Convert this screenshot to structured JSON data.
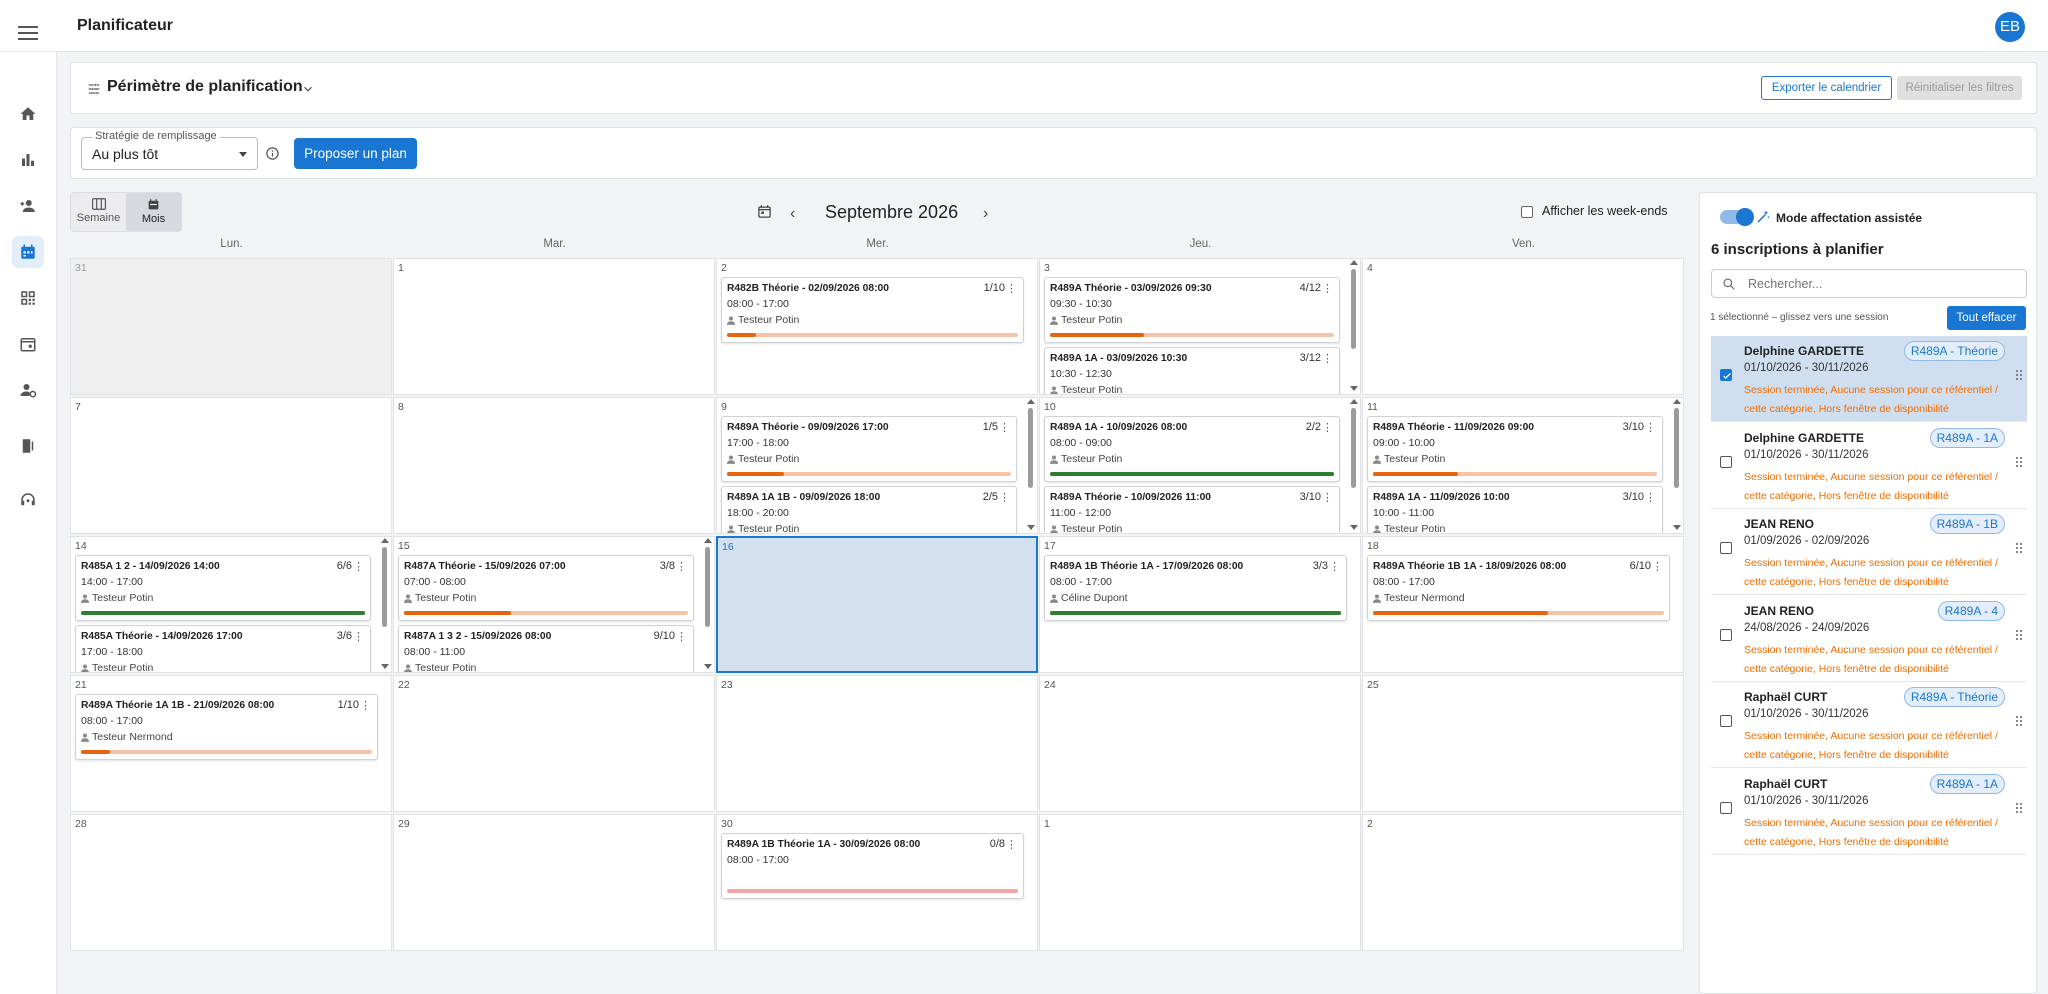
{
  "app": {
    "title": "Planificateur",
    "user_initials": "EB"
  },
  "sidebar": {
    "items": [
      {
        "icon": "home-icon"
      },
      {
        "icon": "bar-chart-icon"
      },
      {
        "icon": "user-add-icon"
      },
      {
        "icon": "calendar-icon",
        "active": true
      },
      {
        "icon": "qr-code-icon"
      },
      {
        "icon": "event-icon"
      },
      {
        "icon": "user-manage-icon"
      },
      {
        "icon": "exit-door-icon"
      },
      {
        "icon": "support-icon"
      }
    ]
  },
  "scope": {
    "title": "Périmètre de planification",
    "export_label": "Exporter le calendrier",
    "reset_label": "Réinitialiser les filtres"
  },
  "strategy": {
    "label": "Stratégie de remplissage",
    "value": "Au plus tôt",
    "propose_label": "Proposer un plan"
  },
  "view": {
    "week_label": "Semaine",
    "month_label": "Mois",
    "active": "Mois"
  },
  "calendar": {
    "month_label": "Septembre 2026",
    "show_weekends_label": "Afficher les week-ends",
    "days_of_week": [
      "Lun.",
      "Mar.",
      "Mer.",
      "Jeu.",
      "Ven."
    ],
    "weeks": [
      [
        {
          "day": "31",
          "other": true,
          "events": []
        },
        {
          "day": "1",
          "events": []
        },
        {
          "day": "2",
          "events": [
            {
              "title": "R482B Théorie - 02/09/2026 08:00",
              "count": "1/10",
              "time": "08:00 - 17:00",
              "trainer": "Testeur Potin",
              "fill": 0.1,
              "color": "#e8650f"
            }
          ]
        },
        {
          "day": "3",
          "scroll": true,
          "events": [
            {
              "title": "R489A Théorie - 03/09/2026 09:30",
              "count": "4/12",
              "time": "09:30 - 10:30",
              "trainer": "Testeur Potin",
              "fill": 0.33,
              "color": "#e8650f"
            },
            {
              "title": "R489A 1A - 03/09/2026 10:30",
              "count": "3/12",
              "time": "10:30 - 12:30",
              "trainer": "Testeur Potin",
              "fill": 0.25,
              "color": "#e8650f"
            }
          ]
        },
        {
          "day": "4",
          "events": []
        }
      ],
      [
        {
          "day": "7",
          "events": []
        },
        {
          "day": "8",
          "events": []
        },
        {
          "day": "9",
          "scroll": true,
          "events": [
            {
              "title": "R489A Théorie - 09/09/2026 17:00",
              "count": "1/5",
              "time": "17:00 - 18:00",
              "trainer": "Testeur Potin",
              "fill": 0.2,
              "color": "#e8650f"
            },
            {
              "title": "R489A 1A 1B - 09/09/2026 18:00",
              "count": "2/5",
              "time": "18:00 - 20:00",
              "trainer": "Testeur Potin",
              "fill": 0.4,
              "color": "#e8650f"
            }
          ]
        },
        {
          "day": "10",
          "scroll": true,
          "events": [
            {
              "title": "R489A 1A - 10/09/2026 08:00",
              "count": "2/2",
              "time": "08:00 - 09:00",
              "trainer": "Testeur Potin",
              "fill": 1.0,
              "color": "#2e7d32"
            },
            {
              "title": "R489A Théorie - 10/09/2026 11:00",
              "count": "3/10",
              "time": "11:00 - 12:00",
              "trainer": "Testeur Potin",
              "fill": 0.3,
              "color": "#e8650f"
            }
          ]
        },
        {
          "day": "11",
          "scroll": true,
          "events": [
            {
              "title": "R489A Théorie - 11/09/2026 09:00",
              "count": "3/10",
              "time": "09:00 - 10:00",
              "trainer": "Testeur Potin",
              "fill": 0.3,
              "color": "#e8650f"
            },
            {
              "title": "R489A 1A - 11/09/2026 10:00",
              "count": "3/10",
              "time": "10:00 - 11:00",
              "trainer": "Testeur Potin",
              "fill": 0.3,
              "color": "#e8650f"
            }
          ]
        }
      ],
      [
        {
          "day": "14",
          "scroll": true,
          "events": [
            {
              "title": "R485A 1 2 - 14/09/2026 14:00",
              "count": "6/6",
              "time": "14:00 - 17:00",
              "trainer": "Testeur Potin",
              "fill": 1.0,
              "color": "#2e7d32"
            },
            {
              "title": "R485A Théorie - 14/09/2026 17:00",
              "count": "3/6",
              "time": "17:00 - 18:00",
              "trainer": "Testeur Potin",
              "fill": 0.5,
              "color": "#e8650f"
            }
          ]
        },
        {
          "day": "15",
          "scroll": true,
          "events": [
            {
              "title": "R487A Théorie - 15/09/2026 07:00",
              "count": "3/8",
              "time": "07:00 - 08:00",
              "trainer": "Testeur Potin",
              "fill": 0.375,
              "color": "#e8650f"
            },
            {
              "title": "R487A 1 3 2 - 15/09/2026 08:00",
              "count": "9/10",
              "time": "08:00 - 11:00",
              "trainer": "Testeur Potin",
              "fill": 0.9,
              "color": "#e8650f"
            }
          ]
        },
        {
          "day": "16",
          "today": true,
          "events": []
        },
        {
          "day": "17",
          "events": [
            {
              "title": "R489A 1B Théorie 1A - 17/09/2026 08:00",
              "count": "3/3",
              "time": "08:00 - 17:00",
              "trainer": "Céline Dupont",
              "fill": 1.0,
              "color": "#2e7d32"
            }
          ]
        },
        {
          "day": "18",
          "events": [
            {
              "title": "R489A Théorie 1B 1A - 18/09/2026 08:00",
              "count": "6/10",
              "time": "08:00 - 17:00",
              "trainer": "Testeur Nermond",
              "fill": 0.6,
              "color": "#e8650f"
            }
          ]
        }
      ],
      [
        {
          "day": "21",
          "events": [
            {
              "title": "R489A Théorie 1A 1B - 21/09/2026 08:00",
              "count": "1/10",
              "time": "08:00 - 17:00",
              "trainer": "Testeur Nermond",
              "fill": 0.1,
              "color": "#e8650f"
            }
          ]
        },
        {
          "day": "22",
          "events": []
        },
        {
          "day": "23",
          "events": []
        },
        {
          "day": "24",
          "events": []
        },
        {
          "day": "25",
          "events": []
        }
      ],
      [
        {
          "day": "28",
          "events": []
        },
        {
          "day": "29",
          "events": []
        },
        {
          "day": "30",
          "events": [
            {
              "title": "R489A 1B Théorie 1A - 30/09/2026 08:00",
              "count": "0/8",
              "time": "08:00 - 17:00",
              "trainer": "",
              "fill": 0.0,
              "color": "#e57373"
            }
          ]
        },
        {
          "day": "1",
          "events": []
        },
        {
          "day": "2",
          "events": []
        }
      ]
    ]
  },
  "panel": {
    "assist_label": "Mode affectation assistée",
    "title": "6 inscriptions à planifier",
    "search_placeholder": "Rechercher...",
    "selected_info": "1 sélectionné – glissez vers une session",
    "clear_label": "Tout effacer",
    "inscriptions": [
      {
        "name": "Delphine GARDETTE",
        "dates": "01/10/2026 - 30/11/2026",
        "tag": "R489A - Théorie",
        "warning": "Session terminée, Aucune session pour ce référentiel / cette catégorie, Hors fenêtre de disponibilité",
        "selected": true
      },
      {
        "name": "Delphine GARDETTE",
        "dates": "01/10/2026 - 30/11/2026",
        "tag": "R489A - 1A",
        "warning": "Session terminée, Aucune session pour ce référentiel / cette catégorie, Hors fenêtre de disponibilité",
        "selected": false
      },
      {
        "name": "JEAN RENO",
        "dates": "01/09/2026 - 02/09/2026",
        "tag": "R489A - 1B",
        "warning": "Session terminée, Aucune session pour ce référentiel / cette catégorie, Hors fenêtre de disponibilité",
        "selected": false
      },
      {
        "name": "JEAN RENO",
        "dates": "24/08/2026 - 24/09/2026",
        "tag": "R489A - 4",
        "warning": "Session terminée, Aucune session pour ce référentiel / cette catégorie, Hors fenêtre de disponibilité",
        "selected": false
      },
      {
        "name": "Raphaël CURT",
        "dates": "01/10/2026 - 30/11/2026",
        "tag": "R489A - Théorie",
        "warning": "Session terminée, Aucune session pour ce référentiel / cette catégorie, Hors fenêtre de disponibilité",
        "selected": false
      },
      {
        "name": "Raphaël CURT",
        "dates": "01/10/2026 - 30/11/2026",
        "tag": "R489A - 1A",
        "warning": "Session terminée, Aucune session pour ce référentiel / cette catégorie, Hors fenêtre de disponibilité",
        "selected": false
      }
    ]
  }
}
